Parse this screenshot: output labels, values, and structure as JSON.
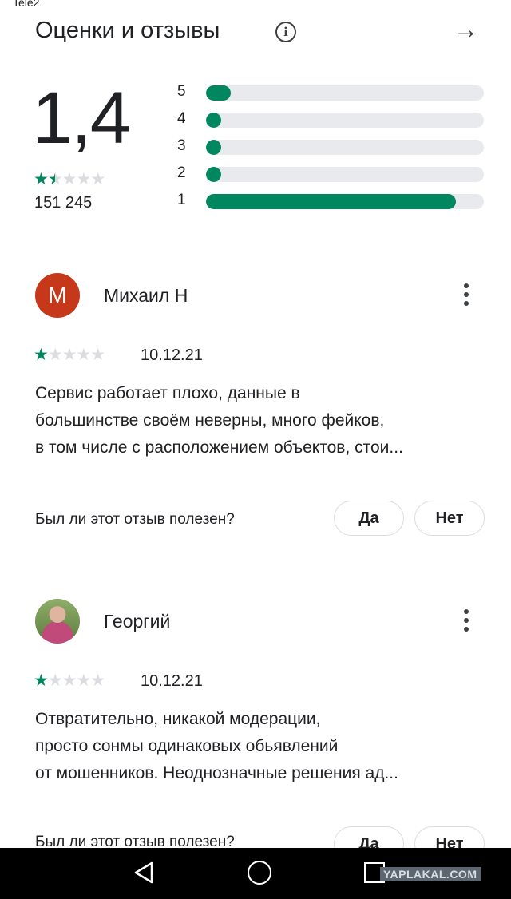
{
  "status_bar": {
    "carrier": "Tele2"
  },
  "header": {
    "title": "Оценки и отзывы",
    "info_icon": "info-icon",
    "forward_icon": "arrow-right-icon"
  },
  "summary": {
    "rating": "1,4",
    "rating_value": 1.4,
    "stars": "★★★★★",
    "count": "151 245",
    "distribution": [
      {
        "label": "5",
        "fraction": 0.09
      },
      {
        "label": "4",
        "fraction": 0.03
      },
      {
        "label": "3",
        "fraction": 0.03
      },
      {
        "label": "2",
        "fraction": 0.03
      },
      {
        "label": "1",
        "fraction": 0.9
      }
    ],
    "accent_color": "#01875f"
  },
  "reviews": [
    {
      "initial": "М",
      "author": "Михаил Н",
      "stars": 1,
      "date": "10.12.21",
      "lines": [
        "Сервис работает плохо, данные в",
        "большинстве своём неверны, много фейков,",
        "в том числе с расположением объектов, стои..."
      ],
      "helpful_question": "Был ли этот отзыв полезен?",
      "yes": "Да",
      "no": "Нет"
    },
    {
      "author": "Георгий",
      "stars": 1,
      "date": "10.12.21",
      "lines": [
        "Отвратительно, никакой модерации,",
        "просто сонмы одинаковых обьявлений",
        "от мошенников. Неоднозначные решения ад..."
      ],
      "helpful_question": "Был ли этот отзыв полезен?",
      "yes": "Да",
      "no": "Нет"
    }
  ],
  "watermark": "YAPLAKAL.COM"
}
